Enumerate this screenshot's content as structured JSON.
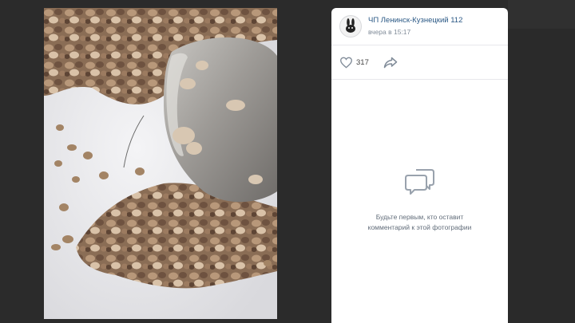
{
  "post": {
    "author_name": "ЧП Ленинск-Кузнецкий 112",
    "time": "вчера в 15:17",
    "likes": "317"
  },
  "comments": {
    "empty_line1": "Будьте первым, кто оставит",
    "empty_line2": "комментарий к этой фотографии"
  },
  "icons": {
    "avatar": "rabbit-logo-icon",
    "like": "heart-icon",
    "share": "share-arrow-icon",
    "comments": "comment-bubble-icon"
  },
  "colors": {
    "link": "#2a5885",
    "muted": "#818c99",
    "icon": "#99a2ad"
  }
}
